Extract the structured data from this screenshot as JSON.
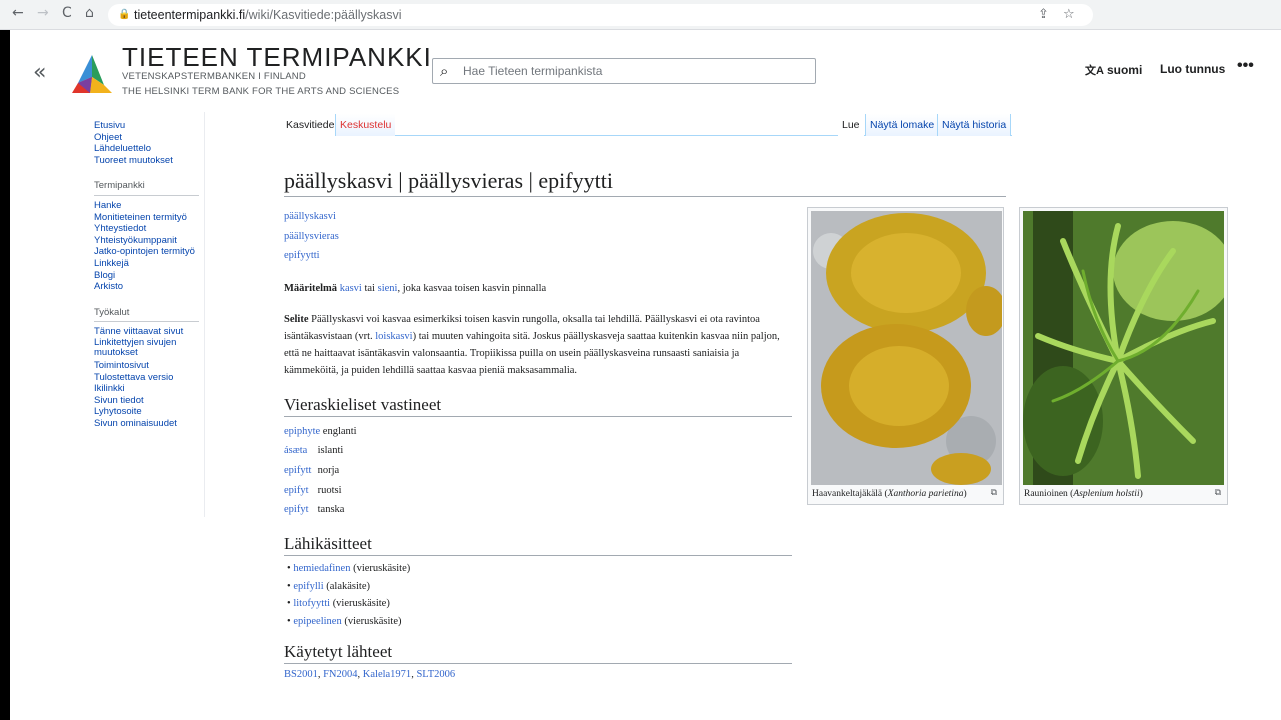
{
  "browser": {
    "back": "←",
    "forward": "→",
    "reload": "C",
    "home": "⌂",
    "url_host": "tieteentermipankki.fi",
    "url_path": "/wiki/Kasvitiede:päällyskasvi"
  },
  "header": {
    "title": "TIETEEN TERMIPANKKI",
    "subtitle_sv": "VETENSKAPSTERMBANKEN I FINLAND",
    "subtitle_en": "THE HELSINKI TERM BANK FOR THE ARTS AND SCIENCES",
    "search_placeholder": "Hae Tieteen termipankista",
    "language": "suomi",
    "create_account": "Luo tunnus",
    "more": "•••"
  },
  "sidebar": {
    "main": [
      "Etusivu",
      "Ohjeet",
      "Lähdeluettelo",
      "Tuoreet muutokset"
    ],
    "termipankki_heading": "Termipankki",
    "termipankki": [
      "Hanke",
      "Monitieteinen termityö",
      "Yhteystiedot",
      "Yhteistyökumppanit",
      "Jatko-opintojen termityö",
      "Linkkejä",
      "Blogi",
      "Arkisto"
    ],
    "tools_heading": "Työkalut",
    "tools": [
      "Tänne viittaavat sivut",
      "Linkitettyjen sivujen muutokset",
      "Toimintosivut",
      "Tulostettava versio",
      "Ikilinkki",
      "Sivun tiedot",
      "Lyhytosoite",
      "Sivun ominaisuudet"
    ]
  },
  "tabs": {
    "namespace": "Kasvitiede",
    "discussion": "Keskustelu",
    "read": "Lue",
    "form": "Näytä lomake",
    "history": "Näytä historia"
  },
  "article": {
    "title": "päällyskasvi | päällysvieras | epifyytti",
    "synonyms": [
      "päällyskasvi",
      "päällysvieras",
      "epifyytti"
    ],
    "definition_label": "Määritelmä",
    "definition_link1": "kasvi",
    "definition_mid": " tai ",
    "definition_link2": "sieni",
    "definition_rest": ", joka kasvaa toisen kasvin pinnalla",
    "note_label": "Selite",
    "note_part1": " Päällyskasvi voi kasvaa esimerkiksi toisen kasvin rungolla, oksalla tai lehdillä. Päällyskasvi ei ota ravintoa isäntäkasvistaan (vrt. ",
    "note_link": "loiskasvi",
    "note_part2": ") tai muuten vahingoita sitä. Joskus päällyskasveja saattaa kuitenkin kasvaa niin paljon, että ne haittaavat isäntäkasvin valonsaantia. Tropiikissa puilla on usein päällyskasveina runsaasti saniaisia ja kämmeköitä, ja puiden lehdillä saattaa kasvaa pieniä maksasammalia.",
    "foreign_heading": "Vieraskieliset vastineet",
    "foreign": [
      {
        "term": "epiphyte",
        "lang": "englanti"
      },
      {
        "term": "ásæta",
        "lang": "islanti"
      },
      {
        "term": "epifytt",
        "lang": "norja"
      },
      {
        "term": "epifyt",
        "lang": "ruotsi"
      },
      {
        "term": "epifyt",
        "lang": "tanska"
      }
    ],
    "related_heading": "Lähikäsitteet",
    "related": [
      {
        "term": "hemiedafinen",
        "type": " (vieruskäsite)"
      },
      {
        "term": "epifylli",
        "type": " (alakäsite)"
      },
      {
        "term": "litofyytti",
        "type": " (vieruskäsite)"
      },
      {
        "term": "epipeelinen",
        "type": " (vieruskäsite)"
      }
    ],
    "sources_heading": "Käytetyt lähteet",
    "sources": [
      "BS2001",
      "FN2004",
      "Kalela1971",
      "SLT2006"
    ]
  },
  "figures": [
    {
      "caption": "Haavankeltajäkälä (",
      "species": "Xanthoria parietina",
      "caption_end": ")"
    },
    {
      "caption": "Raunioinen (",
      "species": "Asplenium holstii",
      "caption_end": ")"
    }
  ]
}
